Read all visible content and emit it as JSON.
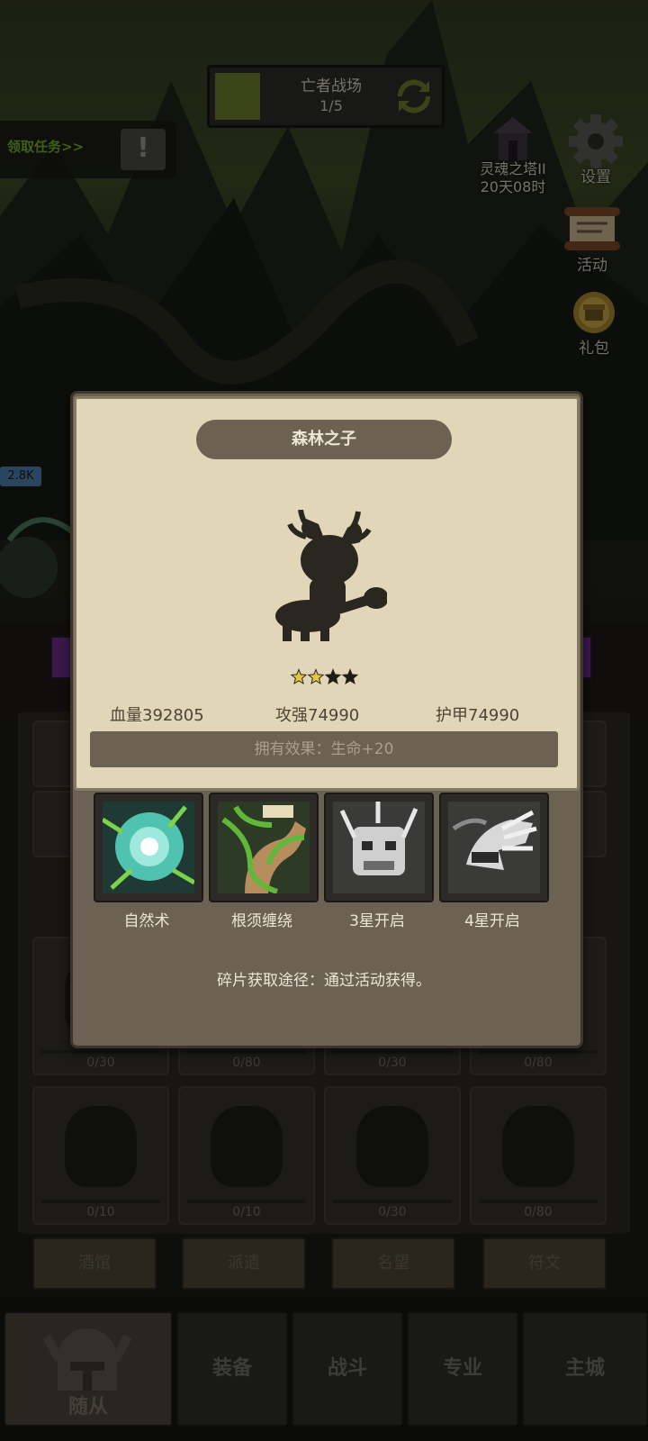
{
  "hud": {
    "stage_name": "亡者战场",
    "stage_progress": "1/5",
    "task_text": "领取任务>>",
    "task_alert": "!",
    "tower_name": "灵魂之塔II",
    "tower_timer": "20天08时",
    "settings_label": "设置",
    "events_label": "活动",
    "gift_label": "礼包",
    "hp_tag": "2.8K"
  },
  "modal": {
    "hero_name": "森林之子",
    "stars_filled": 2,
    "stars_total": 4,
    "stats": {
      "hp": "血量392805",
      "attack": "攻强74990",
      "armor": "护甲74990"
    },
    "owned_effect": "拥有效果：生命+20",
    "skills": [
      {
        "label": "自然术"
      },
      {
        "label": "根须缠绕"
      },
      {
        "label": "3星开启"
      },
      {
        "label": "4星开启"
      }
    ],
    "source_text": "碎片获取途径：通过活动获得。"
  },
  "grid": {
    "counts": [
      "0/30",
      "0/80",
      "0/30",
      "0/80",
      "0/10",
      "0/10",
      "0/30",
      "0/80"
    ]
  },
  "sub_tabs": [
    "酒馆",
    "派遣",
    "名望",
    "符文"
  ],
  "nav": {
    "tabs": [
      "随从",
      "装备",
      "战斗",
      "专业",
      "主城"
    ],
    "active": 0
  },
  "colors": {
    "parchment": "#e2d6b8",
    "modal_frame": "#6b6253",
    "star_gold": "#e6c740",
    "task_green": "#6fae2e"
  }
}
